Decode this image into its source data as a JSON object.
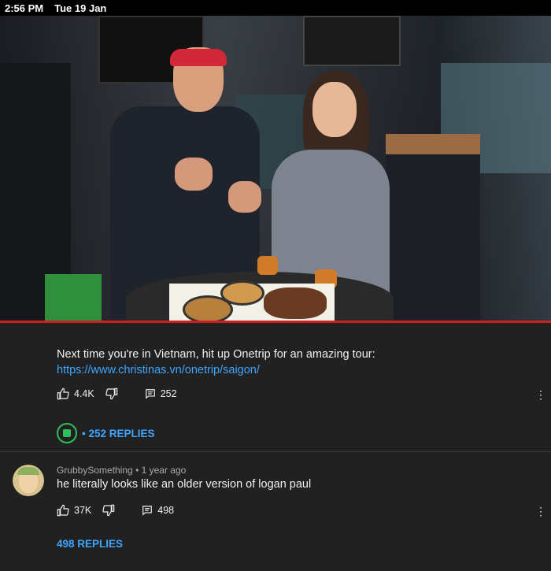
{
  "status_bar": {
    "time": "2:56 PM",
    "date": "Tue 19 Jan"
  },
  "video": {
    "thumbnail_icon": "video-frame",
    "progress_color": "#cc1f1f"
  },
  "description": {
    "text": "Next time you're in Vietnam, hit up Onetrip for an amazing tour: ",
    "link": "https://www.christinas.vn/onetrip/saigon/",
    "likes": "4.4K",
    "reply_count": "252",
    "replies_label": "• 252 REPLIES"
  },
  "comment": {
    "author": "GrubbySomething",
    "time": "• 1 year ago",
    "text": "he literally looks like an older version of logan paul",
    "likes": "37K",
    "reply_count": "498",
    "replies_label": "498 REPLIES"
  },
  "colors": {
    "link": "#3ea6ff",
    "background": "#212121",
    "badge": "#2fbf5a"
  }
}
